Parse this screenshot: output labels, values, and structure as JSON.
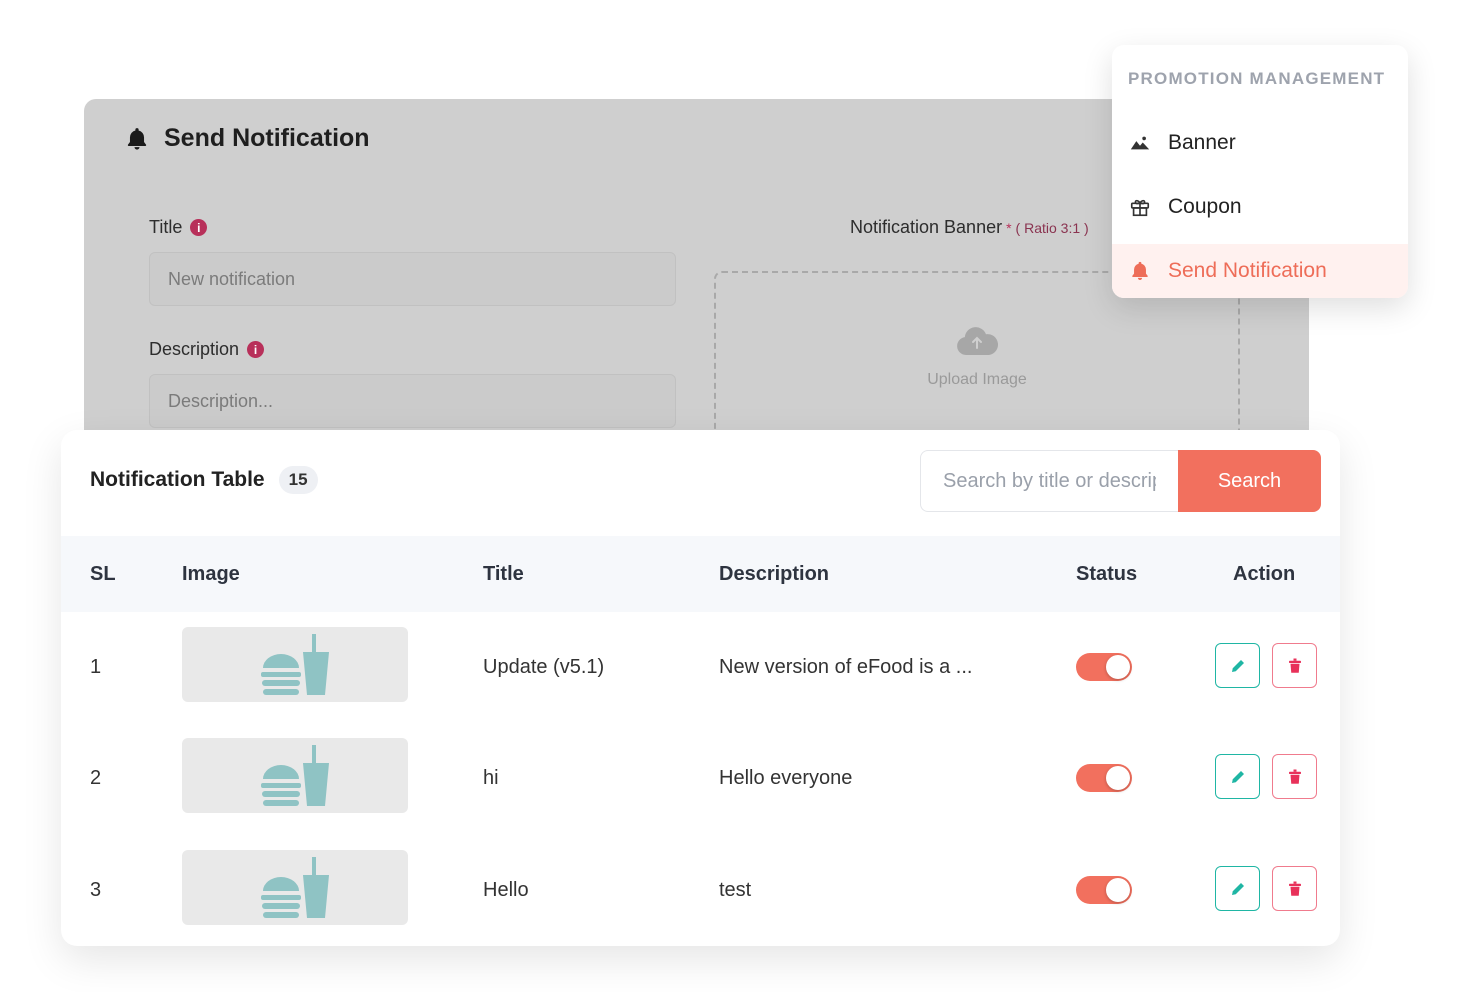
{
  "send_notification_form": {
    "title": "Send Notification",
    "title_label": "Title",
    "title_placeholder": "New notification",
    "description_label": "Description",
    "description_placeholder": "Description...",
    "banner_label": "Notification Banner",
    "banner_required": "*",
    "banner_ratio": "( Ratio 3:1 )",
    "upload_text": "Upload Image",
    "info_glyph": "i"
  },
  "promotion_menu": {
    "heading": "PROMOTION MANAGEMENT",
    "items": [
      {
        "label": "Banner",
        "icon": "image-icon",
        "active": false
      },
      {
        "label": "Coupon",
        "icon": "gift-icon",
        "active": false
      },
      {
        "label": "Send Notification",
        "icon": "bell-icon",
        "active": true
      }
    ]
  },
  "notification_table": {
    "title": "Notification Table",
    "count": "15",
    "search_placeholder": "Search by title or description",
    "search_button": "Search",
    "columns": [
      "SL",
      "Image",
      "Title",
      "Description",
      "Status",
      "Action"
    ],
    "rows": [
      {
        "sl": "1",
        "title": "Update (v5.1)",
        "description": "New version of eFood is a ...",
        "status_on": true
      },
      {
        "sl": "2",
        "title": "hi",
        "description": "Hello everyone",
        "status_on": true
      },
      {
        "sl": "3",
        "title": "Hello",
        "description": "test",
        "status_on": true
      }
    ]
  },
  "colors": {
    "accent": "#f2705e",
    "active_menu_bg": "#fff1ef",
    "edit_border": "#1fb6a4",
    "delete_border": "#f07b8d",
    "info_dot": "#b8305a",
    "placeholder_thumb_icon": "#8fc3c4"
  }
}
